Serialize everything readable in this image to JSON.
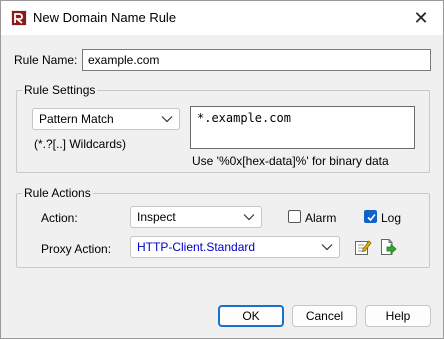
{
  "window": {
    "title": "New Domain Name Rule",
    "close_symbol": "✕"
  },
  "rule_name": {
    "label": "Rule Name:",
    "value": "example.com"
  },
  "rule_settings": {
    "group_title": "Rule Settings",
    "match_type": "Pattern Match",
    "wildcard_hint": "(*.?[..] Wildcards)",
    "pattern": "*.example.com",
    "binary_hint": "Use '%0x[hex-data]%' for binary data"
  },
  "rule_actions": {
    "group_title": "Rule Actions",
    "action_label": "Action:",
    "action_value": "Inspect",
    "alarm_label": "Alarm",
    "alarm_checked": false,
    "log_label": "Log",
    "log_checked": true,
    "proxy_action_label": "Proxy Action:",
    "proxy_action_value": "HTTP-Client.Standard"
  },
  "buttons": {
    "ok": "OK",
    "cancel": "Cancel",
    "help": "Help"
  },
  "colors": {
    "accent": "#1a6fd1",
    "check": "#0f62c7",
    "proxy_text": "#0000c8"
  },
  "icons": [
    "app-icon",
    "close-icon",
    "chevron-down-icon",
    "edit-icon",
    "clone-icon",
    "checkmark-icon"
  ]
}
